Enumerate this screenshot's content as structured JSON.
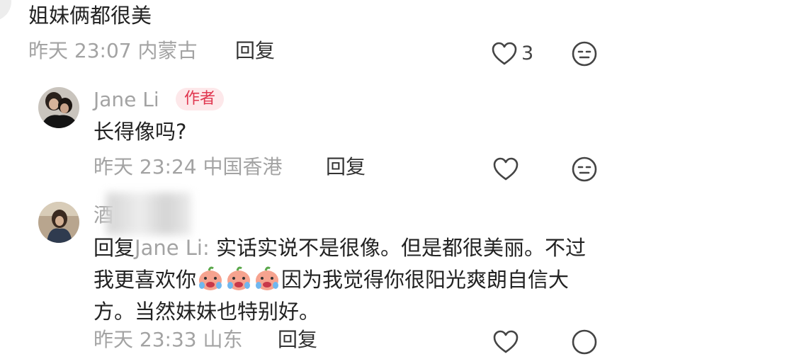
{
  "comment_1": {
    "text": "姐妹俩都很美",
    "meta": "昨天 23:07 内蒙古",
    "reply_label": "回复",
    "like_count": "3"
  },
  "reply_1": {
    "author": "Jane Li",
    "author_badge": "作者",
    "text": "长得像吗?",
    "meta": "昨天 23:24 中国香港",
    "reply_label": "回复"
  },
  "reply_2": {
    "author_visible": "酒",
    "reply_prefix": "回复",
    "reply_to": "Jane Li:",
    "text_part1": " 实话实说不是很像。但是都很美丽。不过我更喜欢你",
    "text_part2": "因为我觉得你很阳光爽朗自信大方。当然妹妹也特别好。",
    "meta_partial": "昨天 23:33 山东",
    "reply_label": "回复"
  },
  "colors": {
    "badge_bg": "#fde8ea",
    "badge_text": "#e0364f",
    "meta_gray": "#a3a3a3"
  }
}
